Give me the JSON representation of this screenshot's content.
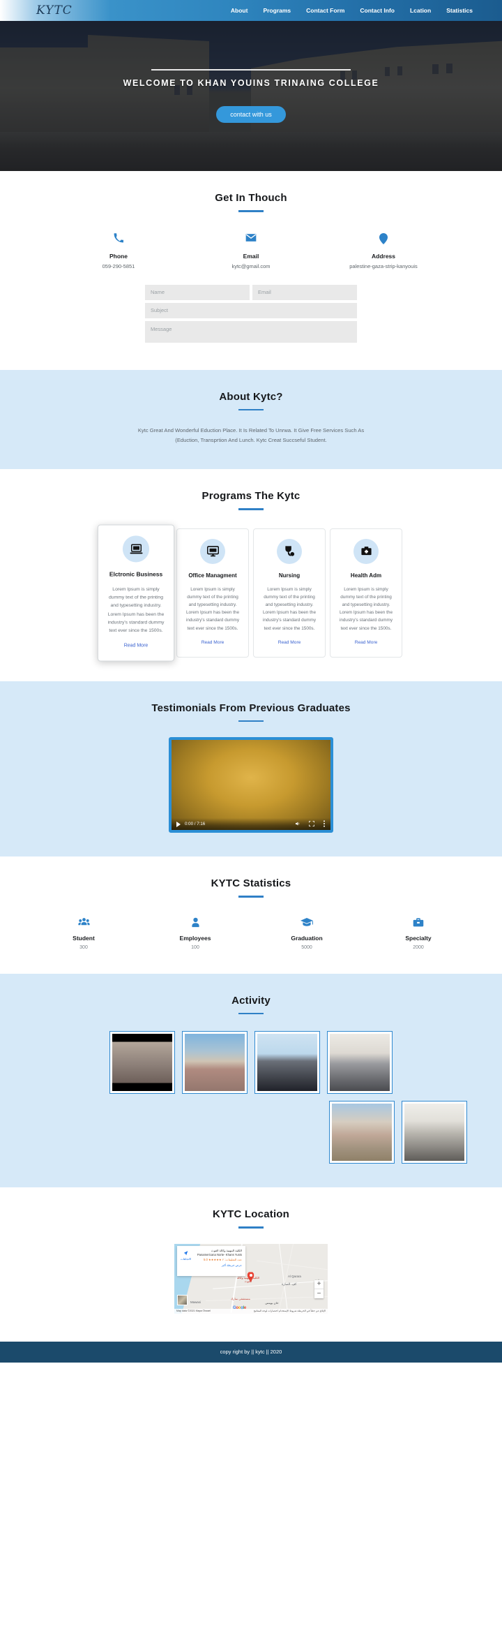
{
  "navbar": {
    "brand": "KYTC",
    "links": [
      {
        "label": "About"
      },
      {
        "label": "Programs"
      },
      {
        "label": "Contact Form"
      },
      {
        "label": "Contact Info"
      },
      {
        "label": "Lcation"
      },
      {
        "label": "Statistics"
      }
    ]
  },
  "hero": {
    "title": "WELCOME TO KHAN YOUINS TRINAING COLLEGE",
    "button": "contact with us"
  },
  "contact": {
    "title": "Get In Thouch",
    "items": [
      {
        "icon": "phone-icon",
        "label": "Phone",
        "value": "059-290-5851"
      },
      {
        "icon": "envelope-icon",
        "label": "Email",
        "value": "kytc@gmail.com"
      },
      {
        "icon": "map-pin-icon",
        "label": "Address",
        "value": "palestine-gaza-strip-kanyouis"
      }
    ],
    "form": {
      "name_placeholder": "Name",
      "email_placeholder": "Email",
      "subject_placeholder": "Subject",
      "message_placeholder": "Message"
    }
  },
  "about": {
    "title": "About Kytc?",
    "body": "Kytc Great And Wonderful Eduction Place. It Is Related To Unrwa. It Give Free Services Such As (Eduction, Transprtion And Lunch. Kytc Creat Succseful Student."
  },
  "programs": {
    "title": "Programs The Kytc",
    "read_more": "Read More",
    "body_text": "Lorem Ipsum is simply dummy text of the printing and typesetting industry. Lorem Ipsum has been the industry's standard dummy text ever since the 1500s.",
    "cards": [
      {
        "icon": "laptop-icon",
        "title": "Elctronic Business",
        "featured": true
      },
      {
        "icon": "desktop-monitor-icon",
        "title": "Office Managment",
        "featured": false
      },
      {
        "icon": "stethoscope-icon",
        "title": "Nursing",
        "featured": false
      },
      {
        "icon": "medical-briefcase-icon",
        "title": "Health Adm",
        "featured": false
      }
    ]
  },
  "testimonials": {
    "title": "Testimonials From Previous Graduates",
    "video": {
      "time": "0:00 / 7:16",
      "play_icon": "play-icon",
      "volume_icon": "volume-icon",
      "fullscreen_icon": "fullscreen-icon",
      "more-options_icon": "kebab-menu-icon"
    }
  },
  "statistics": {
    "title": "KYTC Statistics",
    "items": [
      {
        "icon": "users-group-icon",
        "label": "Student",
        "value": "300"
      },
      {
        "icon": "user-icon",
        "label": "Employees",
        "value": "100"
      },
      {
        "icon": "graduation-cap-icon",
        "label": "Graduation",
        "value": "5000"
      },
      {
        "icon": "briefcase-icon",
        "label": "Specialty",
        "value": "2000"
      }
    ]
  },
  "activity": {
    "title": "Activity",
    "photos": [
      {
        "caption": "classroom-audience-photo"
      },
      {
        "caption": "campus-street-photo"
      },
      {
        "caption": "japan-gaza-award-ceremony-photo"
      },
      {
        "caption": "lecture-hall-photo"
      },
      {
        "caption": "outdoor-training-photo"
      },
      {
        "caption": "indoor-ceremony-photo"
      }
    ]
  },
  "location": {
    "title": "KYTC Location",
    "map": {
      "card_title_ar": "الكلية المهنية وكالة الغوث",
      "card_subtitle": "Panamericana Norte- Khans Yunis",
      "rating": "5.0",
      "stars": "★★★★★",
      "reviews_ar": "عدد التعليقات: ٢",
      "view_larger_ar": "عرض خريطة أكبر",
      "pin_label_ar": "الكلية المهنية وكالة الغوث",
      "hospital_label_ar": "مستشفى مبارك",
      "town_label_ar": "خان يوينس",
      "area_label": "Al Qarara",
      "area_label2_ar": "حرارة",
      "area_label3_ar": "كف. الصارة",
      "mawasi_label": "Mawasi",
      "google_letters": [
        "G",
        "o",
        "o",
        "g",
        "l",
        "e"
      ],
      "google_ar": "بوبل",
      "attribution": "Map data ©2021 Mapa ©Israel",
      "terms_ar": "الإبلاغ عن خطأ في الخريطة   شروط الإستخدام   اختصارات لوحة المفاتيح",
      "zoom_in": "+",
      "zoom_out": "−",
      "directions_ar": "الاتجاهات"
    }
  },
  "footer": {
    "text": "copy right by || kytc || 2020"
  },
  "colors": {
    "accent": "#2f80c6",
    "nav_gradient_end": "#1b5c8f",
    "section_blue_bg": "#d6e9f8",
    "footer_bg": "#1b4a6b",
    "button_blue": "#3498db",
    "link_blue": "#3b63d0"
  }
}
